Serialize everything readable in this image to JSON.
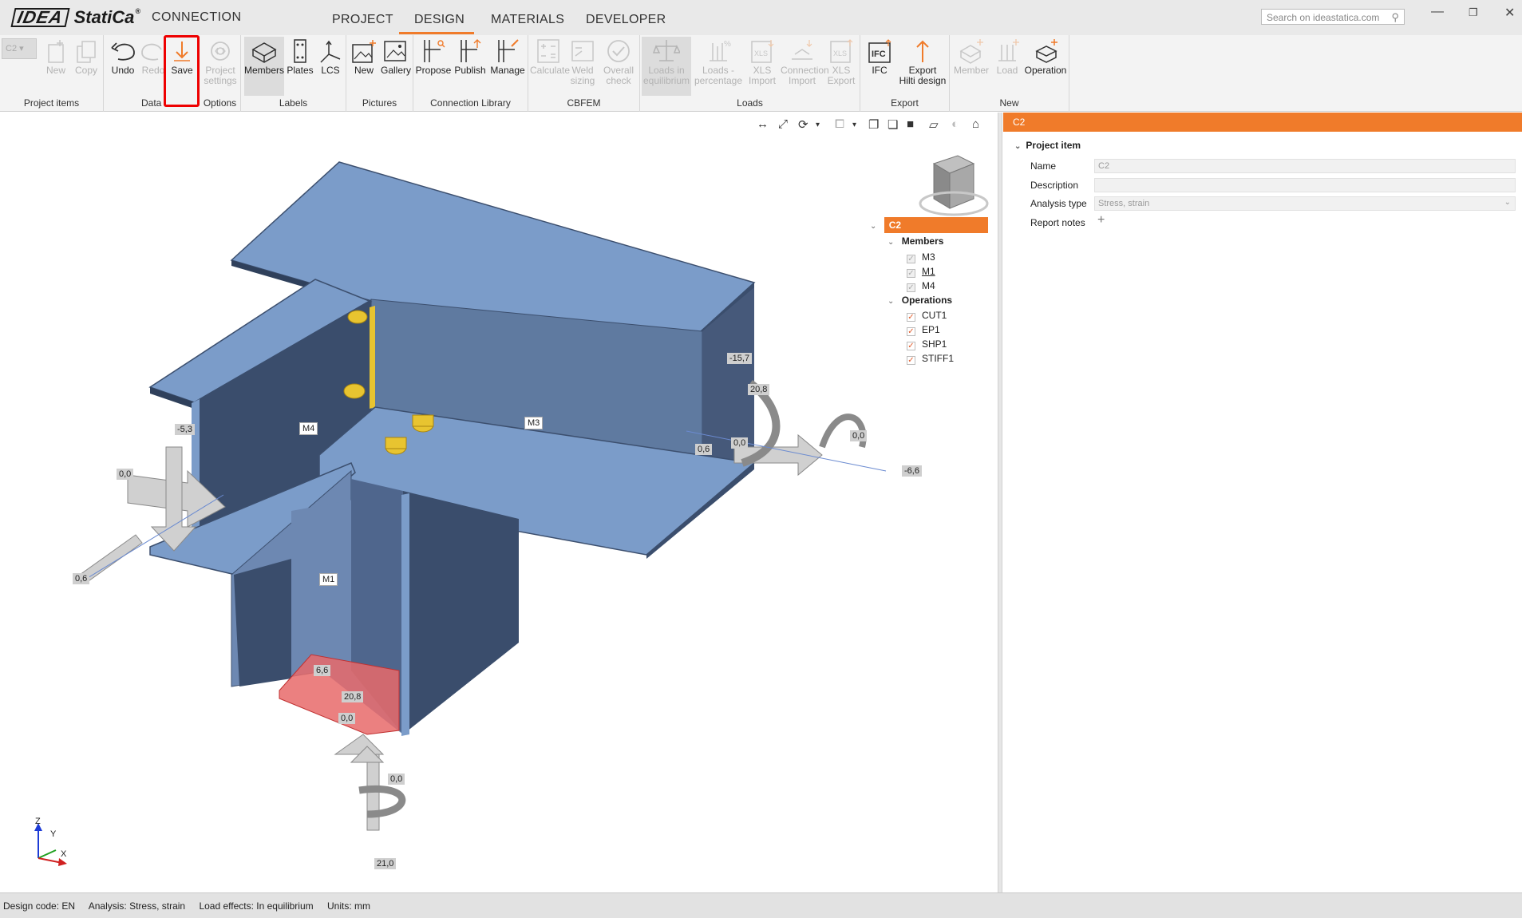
{
  "app": {
    "logo_main": "IDEA",
    "logo_sub": "StatiCa",
    "logo_reg": "®",
    "product": "CONNECTION"
  },
  "menu": {
    "tabs": [
      "PROJECT",
      "DESIGN",
      "MATERIALS",
      "DEVELOPER"
    ],
    "active": "DESIGN"
  },
  "search": {
    "placeholder": "Search on ideastatica.com"
  },
  "ribbon": {
    "project_select": "C2",
    "groups": {
      "project_items": "Project items",
      "data": "Data",
      "options": "Options",
      "labels": "Labels",
      "pictures": "Pictures",
      "connection_library": "Connection Library",
      "cbfem": "CBFEM",
      "loads": "Loads",
      "export": "Export",
      "new": "New"
    },
    "buttons": {
      "new": "New",
      "copy": "Copy",
      "undo": "Undo",
      "redo": "Redo",
      "save": "Save",
      "project_settings_1": "Project",
      "project_settings_2": "settings",
      "members": "Members",
      "plates": "Plates",
      "lcs": "LCS",
      "pic_new": "New",
      "gallery": "Gallery",
      "propose": "Propose",
      "publish": "Publish",
      "manage": "Manage",
      "calculate": "Calculate",
      "weld_sizing_1": "Weld",
      "weld_sizing_2": "sizing",
      "overall_check_1": "Overall",
      "overall_check_2": "check",
      "loads_eq_1": "Loads in",
      "loads_eq_2": "equilibrium",
      "loads_pct_1": "Loads -",
      "loads_pct_2": "percentage",
      "xls_import_1": "XLS",
      "xls_import_2": "Import",
      "conn_import_1": "Connection",
      "conn_import_2": "Import",
      "xls_export_1": "XLS",
      "xls_export_2": "Export",
      "ifc": "IFC",
      "export_hilti_1": "Export",
      "export_hilti_2": "Hilti design",
      "member": "Member",
      "load": "Load",
      "operation": "Operation"
    }
  },
  "scene": {
    "member_labels": {
      "m4": "M4",
      "m3": "M3",
      "m1": "M1"
    },
    "values": {
      "v_53": "-5,3",
      "v_00_left": "0,0",
      "v_06_left": "0,6",
      "v_157": "-15,7",
      "v_208_right": "20,8",
      "v_06_right": "0,6",
      "v_00_right_a": "0,0",
      "v_00_right_b": "0,0",
      "v_66_right": "-6,6",
      "v_66_bottom": "6,6",
      "v_208_bottom": "20,8",
      "v_00_bottom_a": "0,0",
      "v_00_bottom_b": "0,0",
      "v_210": "21,0"
    },
    "axes": {
      "z": "Z",
      "y": "Y",
      "x": "X"
    }
  },
  "tree": {
    "root": "C2",
    "members_label": "Members",
    "members": [
      "M3",
      "M1",
      "M4"
    ],
    "operations_label": "Operations",
    "operations": [
      "CUT1",
      "EP1",
      "SHP1",
      "STIFF1"
    ]
  },
  "properties": {
    "header": "C2",
    "section": "Project item",
    "name_label": "Name",
    "name_value": "C2",
    "description_label": "Description",
    "description_value": "",
    "analysis_label": "Analysis type",
    "analysis_value": "Stress, strain",
    "report_label": "Report notes",
    "report_add": "+"
  },
  "status": {
    "design_code": "Design code: EN",
    "analysis": "Analysis: Stress, strain",
    "load_effects": "Load effects: In equilibrium",
    "units": "Units: mm"
  },
  "colors": {
    "accent": "#f07b2a",
    "steel_top": "#7b9cc9",
    "steel_side": "#3b4e6d",
    "highlight_red": "#e00000"
  }
}
